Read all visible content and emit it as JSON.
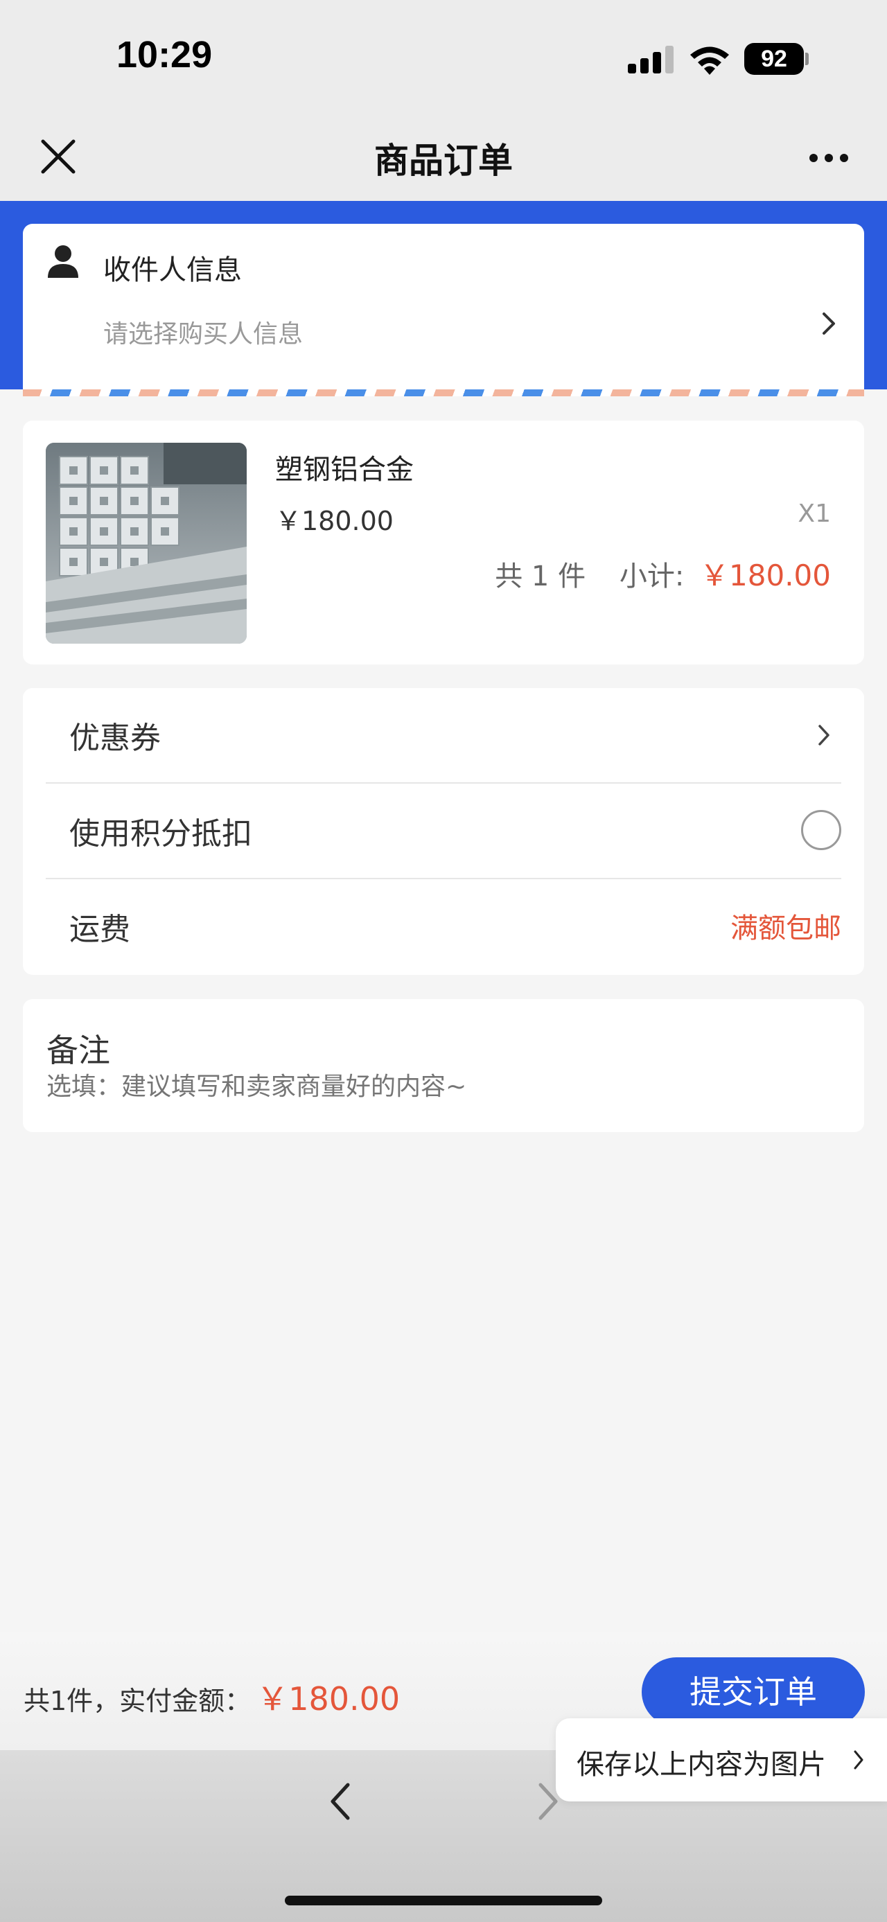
{
  "status_bar": {
    "time": "10:29",
    "battery": "92"
  },
  "nav": {
    "title": "商品订单"
  },
  "recipient": {
    "title": "收件人信息",
    "subtitle": "请选择购买人信息"
  },
  "product": {
    "name": "塑钢铝合金",
    "price": "￥180.00",
    "quantity": "X1",
    "count_label": "共 1 件",
    "subtotal_label": "小计:",
    "subtotal_amount": "￥180.00"
  },
  "options": {
    "coupon_label": "优惠券",
    "points_label": "使用积分抵扣",
    "shipping_label": "运费",
    "shipping_value": "满额包邮"
  },
  "remark": {
    "title": "备注",
    "placeholder": "选填：建议填写和卖家商量好的内容~"
  },
  "bottom": {
    "summary_label": "共1件，实付金额：",
    "amount": "￥180.00",
    "submit_label": "提交订单"
  },
  "popup": {
    "save_label": "保存以上内容为图片"
  },
  "colors": {
    "accent": "#2b5bdf",
    "price": "#e4563a"
  }
}
